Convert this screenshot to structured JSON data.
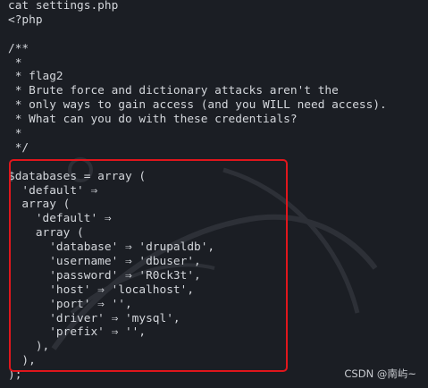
{
  "terminal": {
    "lines": [
      "cat settings.php",
      "<?php",
      "",
      "/**",
      " *",
      " * flag2",
      " * Brute force and dictionary attacks aren't the",
      " * only ways to gain access (and you WILL need access).",
      " * What can you do with these credentials?",
      " *",
      " */",
      "",
      "$databases = array (",
      "  'default' ⇒",
      "  array (",
      "    'default' ⇒",
      "    array (",
      "      'database' ⇒ 'drupaldb',",
      "      'username' ⇒ 'dbuser',",
      "      'password' ⇒ 'R0ck3t',",
      "      'host' ⇒ 'localhost',",
      "      'port' ⇒ '',",
      "      'driver' ⇒ 'mysql',",
      "      'prefix' ⇒ '',",
      "    ),",
      "  ),",
      ");"
    ]
  },
  "annotation": {
    "highlight_color": "#e0161c"
  },
  "credit": {
    "text": "CSDN @南屿~"
  }
}
